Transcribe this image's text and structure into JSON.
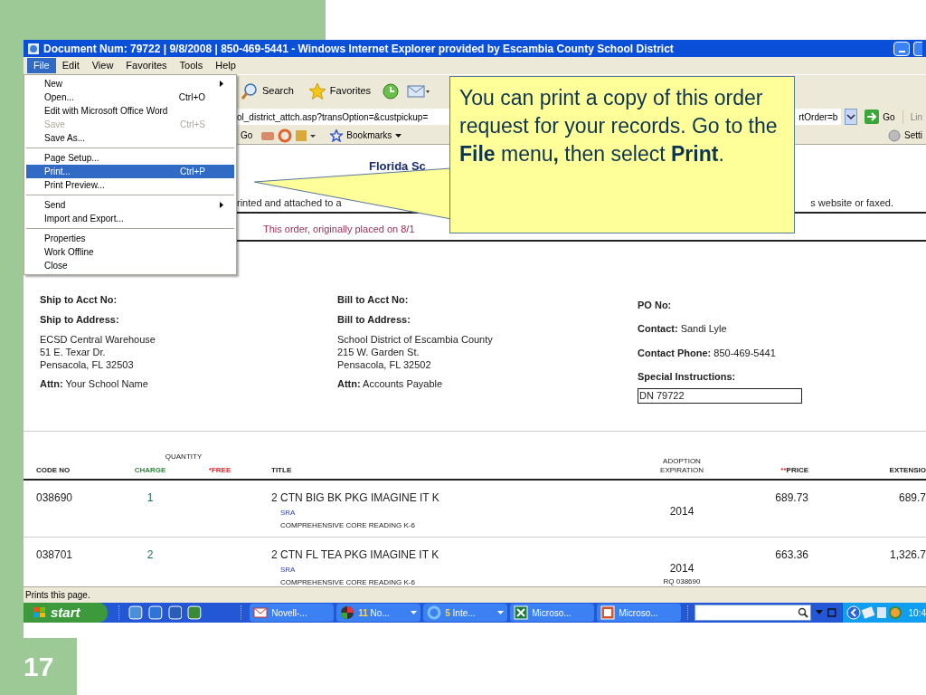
{
  "window": {
    "title": "Document Num: 79722 | 9/8/2008 | 850-469-5441 - Windows Internet Explorer provided by Escambia County School District"
  },
  "menu_bar": [
    {
      "label": "File",
      "selected": true
    },
    {
      "label": "Edit",
      "selected": false
    },
    {
      "label": "View",
      "selected": false
    },
    {
      "label": "Favorites",
      "selected": false
    },
    {
      "label": "Tools",
      "selected": false
    },
    {
      "label": "Help",
      "selected": false
    }
  ],
  "file_menu": {
    "groups": [
      [
        {
          "label": "New",
          "submenu": true,
          "disabled": false,
          "selected": false
        },
        {
          "label": "Open...",
          "shortcut": "Ctrl+O",
          "submenu": false,
          "disabled": false,
          "selected": false
        },
        {
          "label": "Edit with Microsoft Office Word",
          "submenu": false,
          "disabled": false,
          "selected": false
        },
        {
          "label": "Save",
          "shortcut": "Ctrl+S",
          "submenu": false,
          "disabled": true,
          "selected": false
        },
        {
          "label": "Save As...",
          "submenu": false,
          "disabled": false,
          "selected": false
        }
      ],
      [
        {
          "label": "Page Setup...",
          "submenu": false,
          "disabled": false,
          "selected": false
        },
        {
          "label": "Print...",
          "shortcut": "Ctrl+P",
          "submenu": false,
          "disabled": false,
          "selected": true
        },
        {
          "label": "Print Preview...",
          "submenu": false,
          "disabled": false,
          "selected": false
        }
      ],
      [
        {
          "label": "Send",
          "submenu": true,
          "disabled": false,
          "selected": false
        },
        {
          "label": "Import and Export...",
          "submenu": false,
          "disabled": false,
          "selected": false
        }
      ],
      [
        {
          "label": "Properties",
          "submenu": false,
          "disabled": false,
          "selected": false
        },
        {
          "label": "Work Offline",
          "submenu": false,
          "disabled": false,
          "selected": false
        },
        {
          "label": "Close",
          "submenu": false,
          "disabled": false,
          "selected": false
        }
      ]
    ]
  },
  "toolbar": {
    "search": "Search",
    "favorites": "Favorites"
  },
  "address_bar": {
    "url_start": "ol_district_attch.asp?transOption=&custpickup=",
    "url_end": "rtOrder=b",
    "go": "Go",
    "links": "Lin"
  },
  "google_toolbar": {
    "go": "Go",
    "bookmarks": "Bookmarks",
    "settings": "Setti"
  },
  "page": {
    "heading": "Florida Sc",
    "notice_start": "rinted and attached to a",
    "notice_end": "s website or faxed.",
    "modified_note": "This order, originally placed on 8/1",
    "ship_to": {
      "acct_label": "Ship to Acct No:",
      "address_label": "Ship to Address:",
      "address_lines": [
        "ECSD Central Warehouse",
        "51 E. Texar Dr.",
        "Pensacola, FL 32503"
      ],
      "attn_label": "Attn:",
      "attn": "Your School Name"
    },
    "bill_to": {
      "acct_label": "Bill to Acct No:",
      "address_label": "Bill to Address:",
      "address_lines": [
        "School District of Escambia County",
        "215 W. Garden St.",
        "Pensacola, FL 32502"
      ],
      "attn_label": "Attn:",
      "attn": "Accounts Payable"
    },
    "order_info": {
      "po_label": "PO No:",
      "contact_label": "Contact:",
      "contact": "Sandi Lyle",
      "phone_label": "Contact Phone:",
      "phone": "850-469-5441",
      "instructions_label": "Special Instructions:",
      "instructions": "DN 79722"
    },
    "table": {
      "quantity_group": "QUANTITY",
      "columns": [
        {
          "label": "CODE NO"
        },
        {
          "label": "CHARGE",
          "color": "#2e8b3e"
        },
        {
          "label": "*FREE",
          "color": "#e8202a"
        },
        {
          "label": "TITLE"
        },
        {
          "label": "ADOPTION EXPIRATION"
        },
        {
          "mark": "**",
          "label": "PRICE"
        },
        {
          "label": "EXTENSIO"
        }
      ],
      "rows": [
        {
          "code": "038690",
          "charge": "1",
          "title": "2 CTN BIG BK PKG IMAGINE IT K",
          "publisher": "SRA",
          "program": "COMPREHENSIVE CORE READING K-6",
          "expiration": "2014",
          "price": "689.73",
          "extension": "689.7"
        },
        {
          "code": "038701",
          "charge": "2",
          "title": "2 CTN FL TEA PKG IMAGINE IT K",
          "publisher": "SRA",
          "program": "COMPREHENSIVE CORE READING K-6",
          "expiration": "2014",
          "note": "RQ 038690",
          "price": "663.36",
          "extension": "1,326.7"
        }
      ]
    }
  },
  "status_bar": "Prints this page.",
  "taskbar": {
    "start": "start",
    "tasks": [
      {
        "kind": "mail",
        "label": "Novell-...",
        "group": false
      },
      {
        "kind": "globe",
        "count": "11",
        "label": "No...",
        "group": true
      },
      {
        "kind": "ie",
        "count": "5",
        "label": "Inte...",
        "group": true
      },
      {
        "kind": "excel",
        "label": "Microso...",
        "group": false
      },
      {
        "kind": "powerpoint",
        "label": "Microso...",
        "group": false
      }
    ],
    "clock": "10:4"
  },
  "callout": "You can print a copy of this order request for your records. Go to the **File** menu**,** then select **Print**.",
  "slide_number": "17"
}
